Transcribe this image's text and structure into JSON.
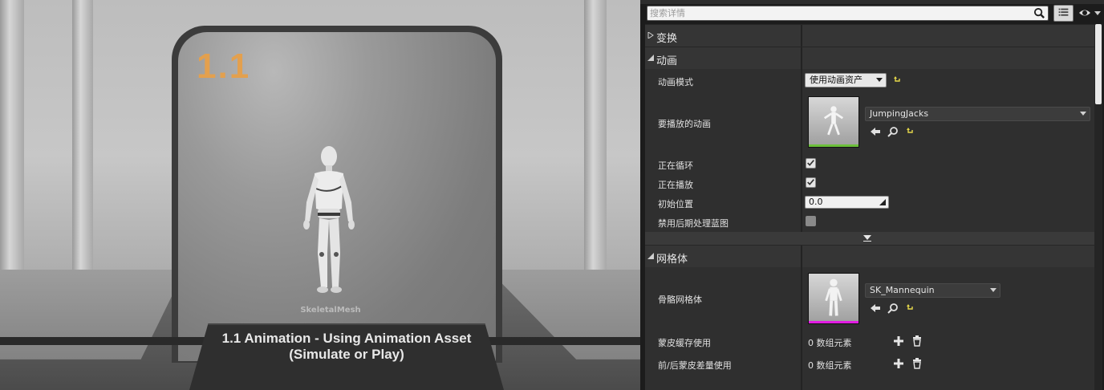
{
  "viewport": {
    "level_number": "1.1",
    "mesh_label": "SkeletalMesh",
    "caption_line1": "1.1  Animation - Using Animation Asset",
    "caption_line2": "(Simulate or Play)"
  },
  "details": {
    "search_placeholder": "搜索详情",
    "categories": {
      "transform": "变换",
      "animation": "动画",
      "mesh": "网格体"
    },
    "animation": {
      "mode_label": "动画模式",
      "mode_value": "使用动画资产",
      "anim_to_play_label": "要播放的动画",
      "anim_asset": "JumpingJacks",
      "looping_label": "正在循环",
      "looping": true,
      "playing_label": "正在播放",
      "playing": true,
      "initial_position_label": "初始位置",
      "initial_position": "0.0",
      "disable_post_process_label": "禁用后期处理蓝图",
      "disable_post_process": false
    },
    "mesh": {
      "skeletal_mesh_label": "骨骼网格体",
      "skeletal_mesh_asset": "SK_Mannequin",
      "skin_cache_label": "蒙皮缓存使用",
      "skin_cache_count": "0 数组元素",
      "morph_target_label": "前/后蒙皮差量使用",
      "morph_target_count": "0 数组元素"
    }
  },
  "colors": {
    "accent_orange": "#e3a04e",
    "anim_asset_bar": "#6bbf3a",
    "mesh_asset_bar": "#e11ce1",
    "panel_bg": "#2f2f2f",
    "category_bg": "#353535"
  },
  "icons": {
    "search": "search-icon",
    "view_options": "list-icon",
    "visibility": "eye-icon",
    "reset": "reset-to-default-icon",
    "browse": "arrow-left-icon",
    "find": "magnifier-icon",
    "add": "plus-icon",
    "delete": "trash-icon"
  }
}
